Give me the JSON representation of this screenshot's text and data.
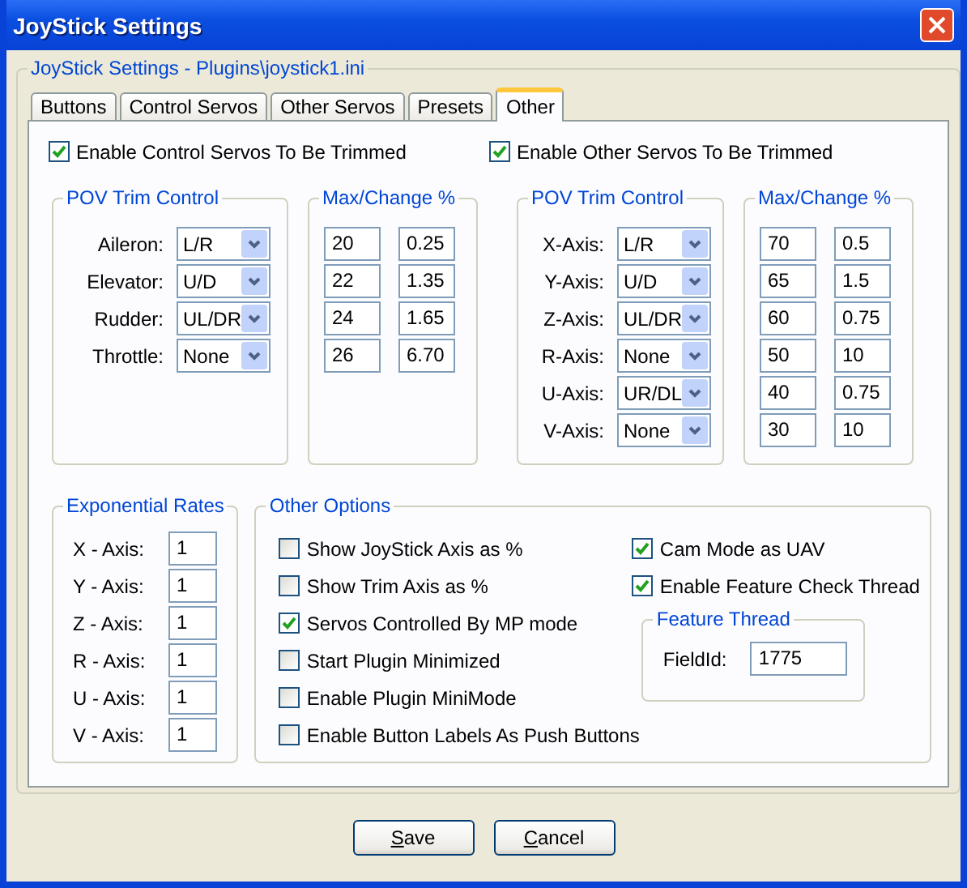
{
  "window": {
    "title": "JoyStick Settings"
  },
  "settings_group": {
    "title": "JoyStick Settings - Plugins\\joystick1.ini"
  },
  "tabs": [
    {
      "label": "Buttons",
      "selected": false
    },
    {
      "label": "Control Servos",
      "selected": false
    },
    {
      "label": "Other Servos",
      "selected": false
    },
    {
      "label": "Presets",
      "selected": false
    },
    {
      "label": "Other",
      "selected": true
    }
  ],
  "servo_sections": [
    {
      "trim_toggle": {
        "label": "Enable Control Servos To Be Trimmed",
        "checked": true
      },
      "pov_title": "POV Trim Control",
      "max_title": "Max/Change %",
      "rows": [
        {
          "label": "Aileron:",
          "mode": "L/R",
          "max": "20",
          "change": "0.25"
        },
        {
          "label": "Elevator:",
          "mode": "U/D",
          "max": "22",
          "change": "1.35"
        },
        {
          "label": "Rudder:",
          "mode": "UL/DR",
          "max": "24",
          "change": "1.65"
        },
        {
          "label": "Throttle:",
          "mode": "None",
          "max": "26",
          "change": "6.70"
        }
      ]
    },
    {
      "trim_toggle": {
        "label": "Enable Other Servos To Be Trimmed",
        "checked": true
      },
      "pov_title": "POV Trim Control",
      "max_title": "Max/Change %",
      "rows": [
        {
          "label": "X-Axis:",
          "mode": "L/R",
          "max": "70",
          "change": "0.5"
        },
        {
          "label": "Y-Axis:",
          "mode": "U/D",
          "max": "65",
          "change": "1.5"
        },
        {
          "label": "Z-Axis:",
          "mode": "UL/DR",
          "max": "60",
          "change": "0.75"
        },
        {
          "label": "R-Axis:",
          "mode": "None",
          "max": "50",
          "change": "10"
        },
        {
          "label": "U-Axis:",
          "mode": "UR/DL",
          "max": "40",
          "change": "0.75"
        },
        {
          "label": "V-Axis:",
          "mode": "None",
          "max": "30",
          "change": "10"
        }
      ]
    }
  ],
  "exponential_rates": {
    "title": "Exponential Rates",
    "rows": [
      {
        "label": "X - Axis:",
        "value": "1"
      },
      {
        "label": "Y - Axis:",
        "value": "1"
      },
      {
        "label": "Z - Axis:",
        "value": "1"
      },
      {
        "label": "R - Axis:",
        "value": "1"
      },
      {
        "label": "U - Axis:",
        "value": "1"
      },
      {
        "label": "V - Axis:",
        "value": "1"
      }
    ]
  },
  "other_options": {
    "title": "Other Options",
    "left": [
      {
        "label": "Show JoyStick Axis as %",
        "checked": false
      },
      {
        "label": "Show Trim Axis as %",
        "checked": false
      },
      {
        "label": "Servos Controlled By MP mode",
        "checked": true
      },
      {
        "label": "Start Plugin Minimized",
        "checked": false
      },
      {
        "label": "Enable Plugin MiniMode",
        "checked": false
      },
      {
        "label": "Enable Button Labels As Push Buttons",
        "checked": false
      }
    ],
    "right": [
      {
        "label": "Cam Mode as UAV",
        "checked": true
      },
      {
        "label": "Enable Feature Check Thread",
        "checked": true
      }
    ],
    "feature_thread": {
      "title": "Feature Thread",
      "label": "FieldId:",
      "value": "1775"
    }
  },
  "buttons": [
    {
      "label": "Save"
    },
    {
      "label": "Cancel"
    }
  ]
}
